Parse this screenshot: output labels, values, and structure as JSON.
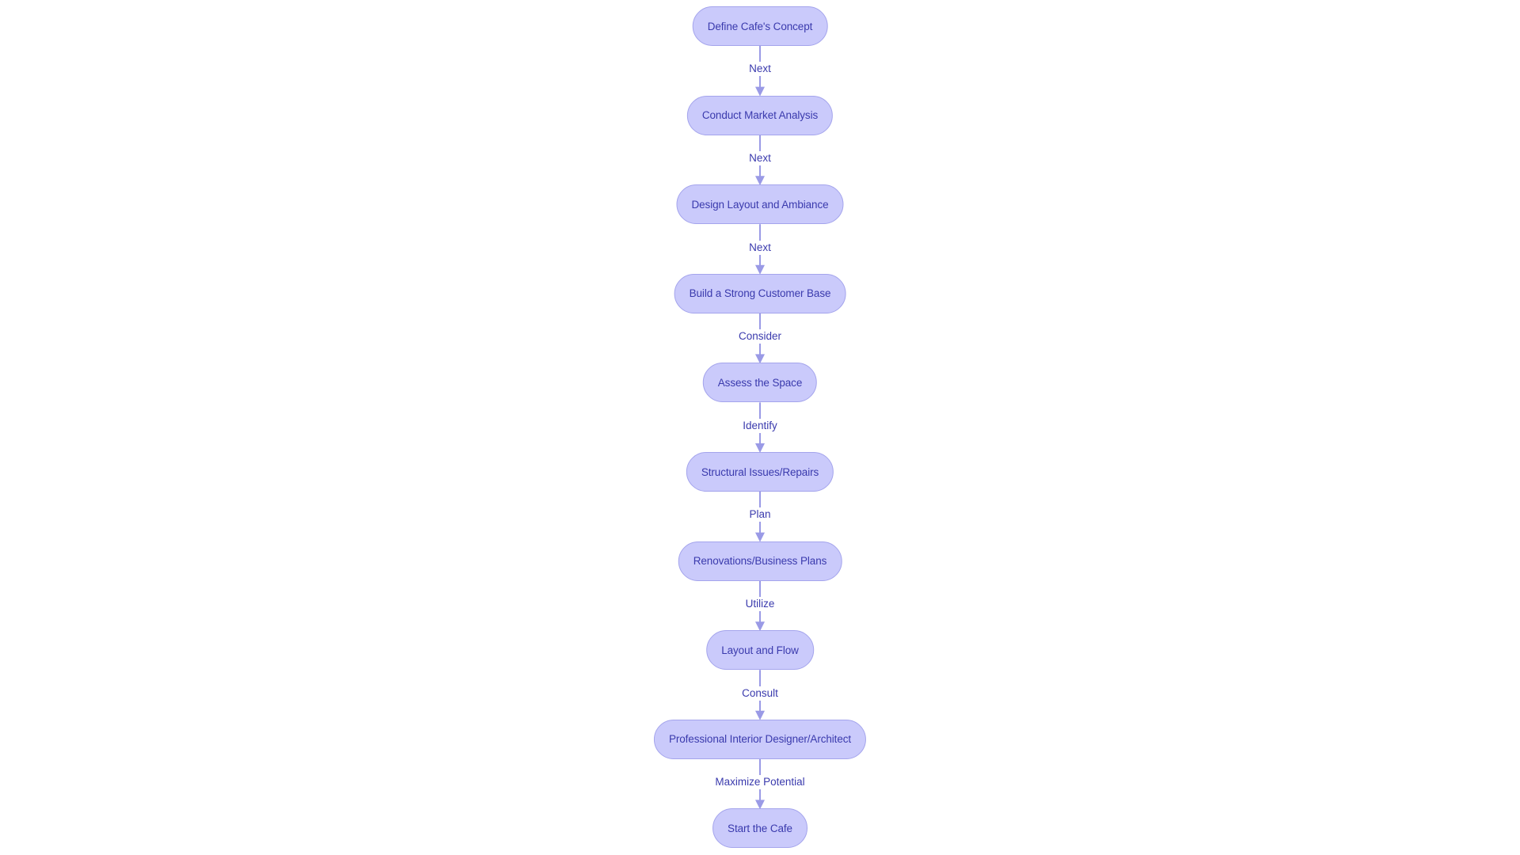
{
  "diagram": {
    "type": "flowchart",
    "direction": "top-to-bottom",
    "colors": {
      "node_fill": "#cacafb",
      "node_border": "#a4a4ec",
      "text": "#3a3aad",
      "edge": "#9a9ae6",
      "background": "#ffffff"
    },
    "nodes": [
      {
        "id": "n1",
        "label": "Define Cafe's Concept"
      },
      {
        "id": "n2",
        "label": "Conduct Market Analysis"
      },
      {
        "id": "n3",
        "label": "Design Layout and Ambiance"
      },
      {
        "id": "n4",
        "label": "Build a Strong Customer Base"
      },
      {
        "id": "n5",
        "label": "Assess the Space"
      },
      {
        "id": "n6",
        "label": "Structural Issues/Repairs"
      },
      {
        "id": "n7",
        "label": "Renovations/Business Plans"
      },
      {
        "id": "n8",
        "label": "Layout and Flow"
      },
      {
        "id": "n9",
        "label": "Professional Interior Designer/Architect"
      },
      {
        "id": "n10",
        "label": "Start the Cafe"
      }
    ],
    "edges": [
      {
        "from": "n1",
        "to": "n2",
        "label": "Next"
      },
      {
        "from": "n2",
        "to": "n3",
        "label": "Next"
      },
      {
        "from": "n3",
        "to": "n4",
        "label": "Next"
      },
      {
        "from": "n4",
        "to": "n5",
        "label": "Consider"
      },
      {
        "from": "n5",
        "to": "n6",
        "label": "Identify"
      },
      {
        "from": "n6",
        "to": "n7",
        "label": "Plan"
      },
      {
        "from": "n7",
        "to": "n8",
        "label": "Utilize"
      },
      {
        "from": "n8",
        "to": "n9",
        "label": "Consult"
      },
      {
        "from": "n9",
        "to": "n10",
        "label": "Maximize Potential"
      }
    ]
  }
}
